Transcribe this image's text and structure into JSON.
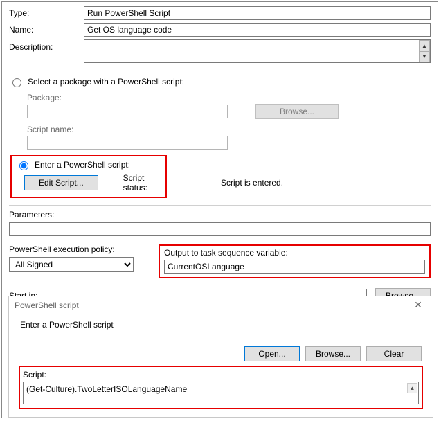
{
  "form": {
    "type_label": "Type:",
    "type_value": "Run PowerShell Script",
    "name_label": "Name:",
    "name_value": "Get OS language code",
    "description_label": "Description:",
    "description_value": ""
  },
  "radio": {
    "select_package_label": "Select a package with a PowerShell script:",
    "enter_script_label": "Enter a PowerShell script:"
  },
  "package": {
    "package_label": "Package:",
    "package_value": "",
    "browse_label": "Browse...",
    "scriptname_label": "Script name:",
    "scriptname_value": ""
  },
  "enter_section": {
    "edit_button": "Edit Script...",
    "status_label": "Script status:",
    "status_value": "Script is entered."
  },
  "parameters": {
    "label": "Parameters:",
    "value": ""
  },
  "exec_policy": {
    "label": "PowerShell execution policy:",
    "value": "All Signed"
  },
  "output_var": {
    "label": "Output to task sequence variable:",
    "value": "CurrentOSLanguage"
  },
  "startin": {
    "label": "Start in:",
    "value": "",
    "browse_label": "Browse..."
  },
  "dialog": {
    "title": "PowerShell script",
    "prompt": "Enter a PowerShell script",
    "open_label": "Open...",
    "browse_label": "Browse...",
    "clear_label": "Clear",
    "script_label": "Script:",
    "script_value": "(Get-Culture).TwoLetterISOLanguageName"
  }
}
